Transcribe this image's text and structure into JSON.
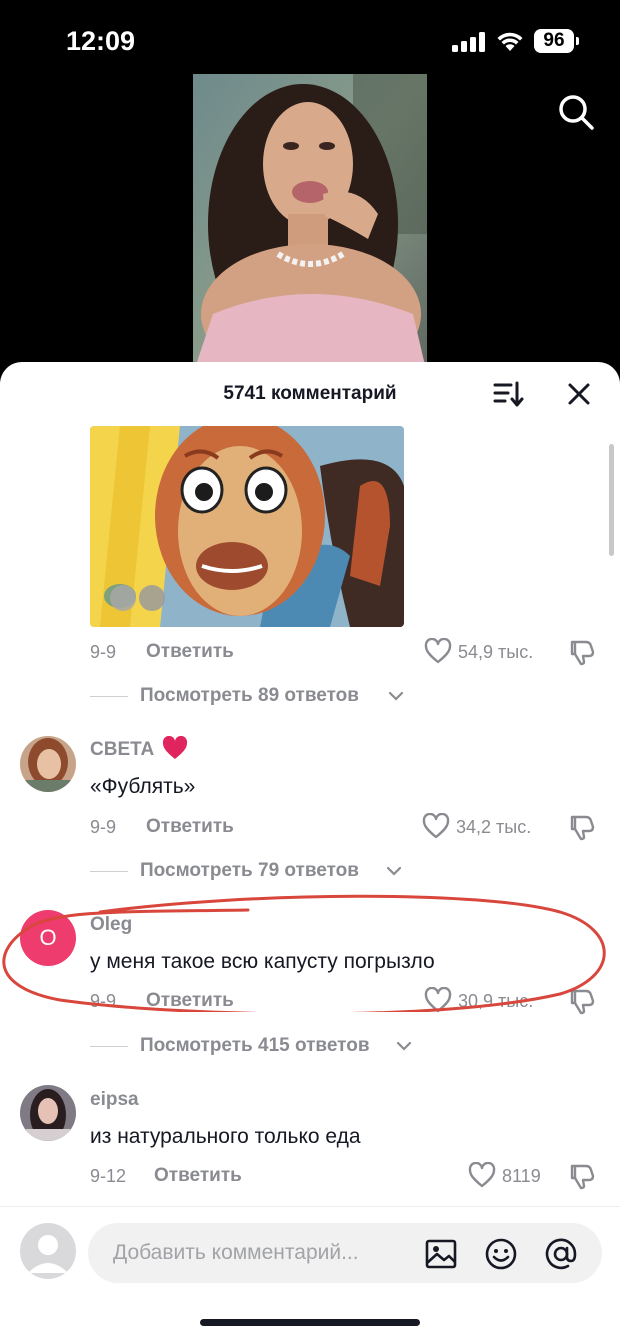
{
  "status": {
    "time": "12:09",
    "battery": "96"
  },
  "sheet": {
    "title": "5741 комментарий"
  },
  "comments": [
    {
      "date": "9-9",
      "reply": "Ответить",
      "likes": "54,9 тыс.",
      "replies": "Посмотреть 89 ответов"
    },
    {
      "user": "СВЕТА",
      "text": "«Фублять»",
      "date": "9-9",
      "reply": "Ответить",
      "likes": "34,2 тыс.",
      "replies": "Посмотреть 79 ответов"
    },
    {
      "user": "Oleg",
      "avatar_letter": "O",
      "text": "у меня такое всю капусту погрызло",
      "date": "9-9",
      "reply": "Ответить",
      "likes": "30,9 тыс.",
      "replies": "Посмотреть 415 ответов"
    },
    {
      "user": "eipsa",
      "text": "из натурального только еда",
      "date": "9-12",
      "reply": "Ответить",
      "likes": "8119"
    }
  ],
  "input": {
    "placeholder": "Добавить комментарий..."
  },
  "colors": {
    "oleg_avatar": "#ee3c6e",
    "annotation": "#d8463c",
    "heart_emoji": "#e0245e"
  }
}
